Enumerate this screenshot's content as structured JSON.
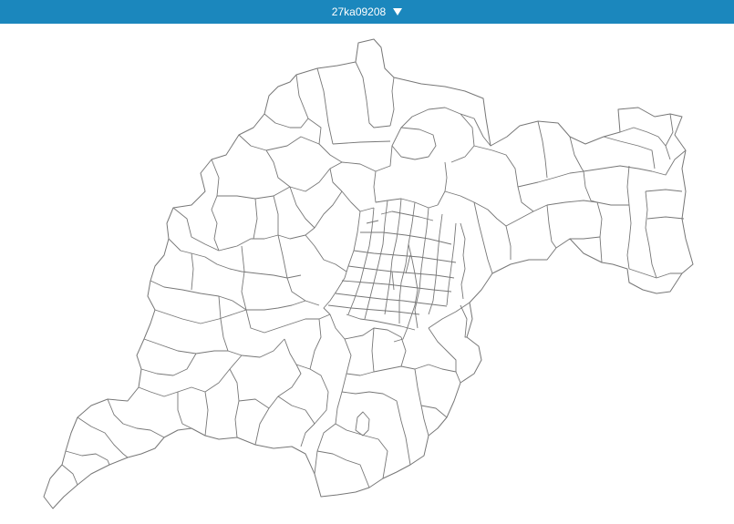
{
  "header": {
    "dataset_label": "27ka09208",
    "dropdown_icon": "chevron-down-icon",
    "accent_color": "#1b87bd"
  },
  "map": {
    "type": "boundary map",
    "stroke_color": "#777777",
    "fill_color": "#ffffff"
  }
}
